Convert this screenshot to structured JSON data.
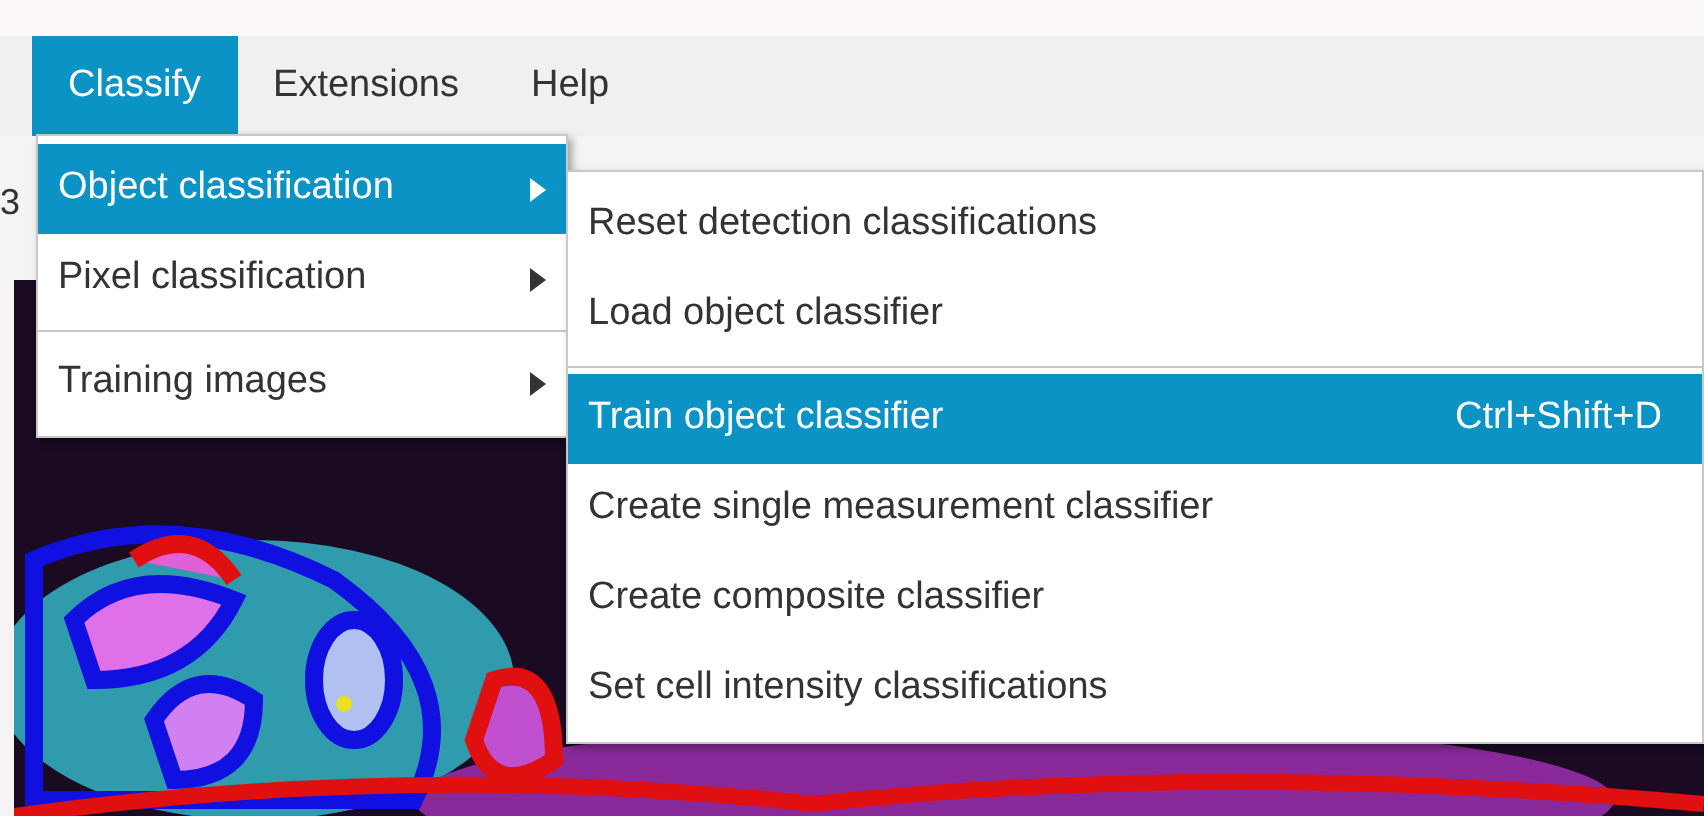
{
  "menu_bar": [
    {
      "label": "Classify",
      "selected": true
    },
    {
      "label": "Extensions",
      "selected": false
    },
    {
      "label": "Help",
      "selected": false
    }
  ],
  "background_label": "3",
  "classify_menu": [
    {
      "label": "Object classification",
      "selected": true,
      "separator_before": false
    },
    {
      "label": "Pixel classification",
      "selected": false,
      "separator_before": false
    },
    {
      "label": "Training images",
      "selected": false,
      "separator_before": true
    }
  ],
  "object_classification_menu": [
    {
      "label": "Reset detection classifications",
      "selected": false,
      "separator_before": false
    },
    {
      "label": "Load object classifier",
      "selected": false,
      "separator_before": false
    },
    {
      "label": "Train object classifier",
      "shortcut": "Ctrl+Shift+D",
      "selected": true,
      "separator_before": true
    },
    {
      "label": "Create single measurement classifier",
      "selected": false,
      "separator_before": false
    },
    {
      "label": "Create composite classifier",
      "selected": false,
      "separator_before": false
    },
    {
      "label": "Set cell intensity classifications",
      "selected": false,
      "separator_before": false
    }
  ]
}
